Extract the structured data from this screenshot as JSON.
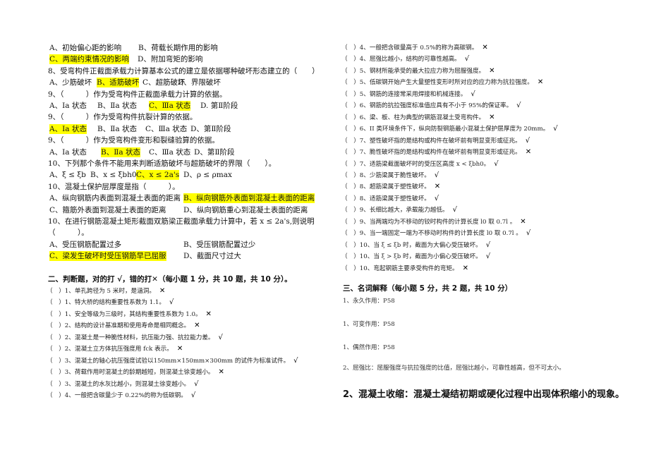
{
  "left": {
    "lines": [
      {
        "options": [
          {
            "text": "A、初始偏心距的影响",
            "highlighted": false
          },
          {
            "text": "B、荷载长期作用的影响",
            "highlighted": false
          }
        ]
      },
      {
        "options": [
          {
            "text": "C、两端约束情况的影响",
            "highlighted": true
          },
          {
            "text": "D、附加弯矩的影响",
            "highlighted": false
          }
        ]
      },
      {
        "text": "8、受弯构件正截面承载力计算基本公式的建立是依据哪种破坏形态建立的（　　）"
      },
      {
        "options": [
          {
            "text": "A、少筋破坏",
            "highlighted": false
          },
          {
            "text": "B、适筋破坏",
            "highlighted": true
          },
          {
            "text": "C、超筋破坏",
            "highlighted": false
          },
          {
            "text": "D、界限破坏",
            "highlighted": false
          }
        ]
      },
      {
        "text": "9、（　　　）作为受弯构件正截面承载力计算的依据。"
      },
      {
        "options": [
          {
            "text": "A、Ⅰa 状态",
            "highlighted": false
          },
          {
            "text": "B、Ⅱa 状态",
            "highlighted": false
          },
          {
            "text": "C、Ⅲa 状态",
            "highlighted": true
          },
          {
            "text": "D. 第Ⅱ阶段",
            "highlighted": false
          }
        ]
      },
      {
        "text": "9、（　　　）作为受弯构件抗裂计算的依据。"
      },
      {
        "options": [
          {
            "text": "A、Ⅰa 状态",
            "highlighted": true
          },
          {
            "text": "B、Ⅱa 状态",
            "highlighted": false
          },
          {
            "text": "C、Ⅲa 状态",
            "highlighted": false
          },
          {
            "text": "D、第Ⅱ阶段",
            "highlighted": false
          }
        ]
      },
      {
        "text": "9、（　　　）作为受弯构件变形和裂缝验算的依据。"
      },
      {
        "options": [
          {
            "text": "A、Ⅰa 状态",
            "highlighted": false
          },
          {
            "text": "B、Ⅱa 状态",
            "highlighted": true
          },
          {
            "text": "C、Ⅲa 状态",
            "highlighted": false
          },
          {
            "text": "D、第Ⅱ阶段",
            "highlighted": false
          }
        ]
      },
      {
        "text": "10、下列那个条件不能用来判断适筋破坏与超筋破坏的界限（　　）。"
      },
      {
        "options": [
          {
            "text": "A、ξ ≤ ξb",
            "highlighted": false
          },
          {
            "text": "B、x ≤ ξbh0",
            "highlighted": false
          },
          {
            "text": "C、x ≤ 2a's",
            "highlighted": true
          },
          {
            "text": "D、ρ ≤ ρmax",
            "highlighted": false
          }
        ]
      },
      {
        "text": "10、混凝土保护层厚度是指（　　　）。"
      },
      {
        "options": [
          {
            "text": "A、纵向钢筋内表面到混凝土表面的距离",
            "highlighted": false
          },
          {
            "text": "B、纵向钢筋外表面到混凝土表面的距离",
            "highlighted": true
          }
        ]
      },
      {
        "options": [
          {
            "text": "C、箍筋外表面到混凝土表面的距离",
            "highlighted": false
          },
          {
            "text": "D、纵向钢筋重心到混凝土表面的距离",
            "highlighted": false
          }
        ]
      },
      {
        "text": "10、在进行钢筋混凝土矩形截面双筋梁正截面承载力计算中，若 x ≤ 2a's,则说明"
      },
      {
        "text": "（　　　）。"
      },
      {
        "options": [
          {
            "text": "A、受压钢筋配置过多",
            "highlighted": false
          },
          {
            "text": "B、受压钢筋配置过少",
            "highlighted": false
          }
        ]
      },
      {
        "options": [
          {
            "text": "C、梁发生破坏时受压钢筋早已屈服",
            "highlighted": true
          },
          {
            "text": "D、截面尺寸过大",
            "highlighted": false
          }
        ]
      }
    ]
  },
  "judge": {
    "title": "二、判断题，对的打 √，错的打✕（每小题 1 分，共 10 题，共 10 分）。",
    "bracket": "（　）",
    "left_rows": [
      {
        "text": "1、单孔跨径为 5 米时，是涵洞。",
        "mark": "✕"
      },
      {
        "text": "1、特大桥的结构重要性系数为 1.1。",
        "mark": "√"
      },
      {
        "text": "1、安全等级为三级时，其结构重要性系数为 1.0。",
        "mark": "✕"
      },
      {
        "text": "2、结构的设计基准期和使用寿命是相同概念。",
        "mark": "✕"
      },
      {
        "text": "2、混凝土是一种脆性材料，抗压能力强、抗拉能力差。",
        "mark": "√"
      },
      {
        "text": "2、混凝土立方体抗压强度用 fck 表示。",
        "mark": "✕"
      },
      {
        "text": "3、混凝土的轴心抗压强度试验以150mm×150mm×300mm 的试件为标准试件。",
        "mark": "√"
      },
      {
        "text": "3、荷载作用时混凝土的龄期越短，则混凝土徐变越小。",
        "mark": "✕"
      },
      {
        "text": "3、混凝土的水灰比越小，则混凝土徐变越小。",
        "mark": "√"
      },
      {
        "text": "4、一般把含碳量少于 0.22%的称为低碳钢。",
        "mark": "√"
      }
    ],
    "right_rows": [
      {
        "text": "4、一般把含碳量高于 0.5%的称为高碳钢。",
        "mark": "✕"
      },
      {
        "text": "4、屈强比越小，结构的可靠性越高。",
        "mark": "√"
      },
      {
        "text": "5、钢材所能承受的最大拉应力称为屈服强度。",
        "mark": "✕"
      },
      {
        "text": "5、低碳钢开始产生大量塑性变形时所对应的应力称为抗拉强度。",
        "mark": "✕"
      },
      {
        "text": "5、钢筋的连接常采用焊接和机械连接。",
        "mark": "√"
      },
      {
        "text": "6、钢筋的抗拉强度标准值应具有不小于 95%的保证率。",
        "mark": "√"
      },
      {
        "text": "6、梁、板、柱为典型的钢筋混凝土受弯构件。",
        "mark": "✕"
      },
      {
        "text": "6、II 类环境条件下，纵向防裂钢筋最小混凝土保护层厚度为 20mm。",
        "mark": "√"
      },
      {
        "text": "7、塑性破坏指的是结构或构件在破坏前有明显变形或征兆。",
        "mark": "√"
      },
      {
        "text": "7、脆性破坏指的是结构或构件在破坏前有明显变形或征兆。",
        "mark": "✕"
      },
      {
        "text": "7、适筋梁截面破坏时的受压区高度 x < ξbh0。",
        "mark": "√"
      },
      {
        "text": "8、少筋梁属于脆性破坏。",
        "mark": "√"
      },
      {
        "text": "8、超筋梁属于塑性破坏。",
        "mark": "✕"
      },
      {
        "text": "8、适筋梁属于塑性破坏。",
        "mark": "√"
      },
      {
        "text": "9、长细比越大，承载能力越低。",
        "mark": "√"
      },
      {
        "text": "9、当两端均为不移动的铰时构件的计算长度 l0 取 0.7l 。",
        "mark": "✕"
      },
      {
        "text": "9、当一端固定一端为不移动时构件的计算长度 l0 取 0.7l 。",
        "mark": "√"
      },
      {
        "text": "10、当 ξ ≤ ξb 时，截面为大偏心受压破坏。",
        "mark": "√"
      },
      {
        "text": "10、当 ξ > ξb 时，截面为小偏心受压破坏。",
        "mark": "√"
      },
      {
        "text": "10、弯起钢筋主要承受构件的弯矩。",
        "mark": "✕"
      }
    ]
  },
  "terms": {
    "title": "三、名词解释（每小题 5 分，共 2 题，共 10 分）",
    "items": [
      "1、永久作用：P58",
      "1、可变作用：P58",
      "1、偶然作用：P58",
      "2、屈强比：屈服强度与抗拉强度的比值，屈强比越小，可靠性越高，但不可太小。"
    ],
    "bold_item": "2、混凝土收缩：混凝土凝结初期或硬化过程中出现体积缩小的现象。"
  },
  "colors": {
    "highlight": "#ffff00"
  }
}
